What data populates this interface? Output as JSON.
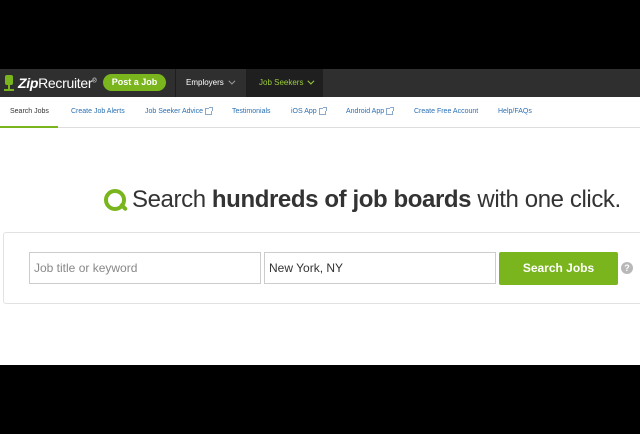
{
  "brand": {
    "logo_bold": "Zip",
    "logo_rest": "Recruiter",
    "logo_mark": "®"
  },
  "topnav": {
    "post_job": "Post a Job",
    "employers": "Employers",
    "job_seekers": "Job Seekers"
  },
  "subnav": {
    "items": [
      {
        "label": "Search Jobs"
      },
      {
        "label": "Create Job Alerts"
      },
      {
        "label": "Job Seeker Advice"
      },
      {
        "label": "Testimonials"
      },
      {
        "label": "iOS App"
      },
      {
        "label": "Android App"
      },
      {
        "label": "Create Free Account"
      },
      {
        "label": "Help/FAQs"
      }
    ]
  },
  "hero": {
    "prefix": "Search ",
    "bold": "hundreds of job boards",
    "suffix": " with one click."
  },
  "search": {
    "keyword_placeholder": "Job title or keyword",
    "keyword_value": "",
    "location_value": "New York, NY",
    "button_label": "Search Jobs",
    "help": "?"
  },
  "colors": {
    "accent": "#7ab51d",
    "nav_bg": "#2f2f2f",
    "link": "#2a6fb2"
  }
}
